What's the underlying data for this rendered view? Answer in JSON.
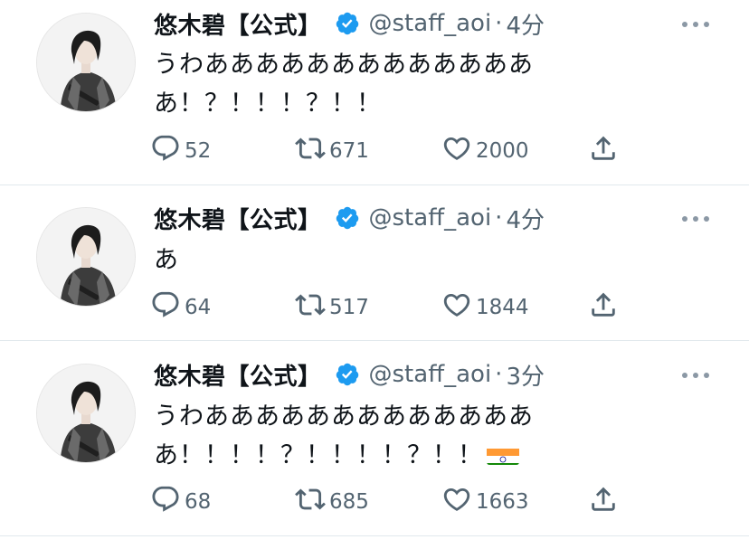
{
  "tweets": [
    {
      "display_name": "悠木碧【公式】",
      "handle": "@staff_aoi",
      "separator": "·",
      "time": "4分",
      "text_lines": [
        "うわあああああああああああああ",
        "あ！？！！！？！！"
      ],
      "flag": "",
      "replies": "52",
      "retweets": "671",
      "likes": "2000"
    },
    {
      "display_name": "悠木碧【公式】",
      "handle": "@staff_aoi",
      "separator": "·",
      "time": "4分",
      "text_lines": [
        "あ",
        ""
      ],
      "flag": "",
      "replies": "64",
      "retweets": "517",
      "likes": "1844"
    },
    {
      "display_name": "悠木碧【公式】",
      "handle": "@staff_aoi",
      "separator": "·",
      "time": "3分",
      "text_lines": [
        "うわあああああああああああああ",
        "あ！！！！？！！！！？！！"
      ],
      "flag": "india-flag",
      "replies": "68",
      "retweets": "685",
      "likes": "1663"
    }
  ],
  "colors": {
    "text": "#0f1419",
    "secondary": "#536471",
    "verified": "#1d9bf0",
    "divider": "#e1e8ed"
  },
  "icons": [
    "avatar",
    "verified-badge-icon",
    "more-icon",
    "reply-icon",
    "retweet-icon",
    "like-icon",
    "share-icon",
    "india-flag"
  ]
}
